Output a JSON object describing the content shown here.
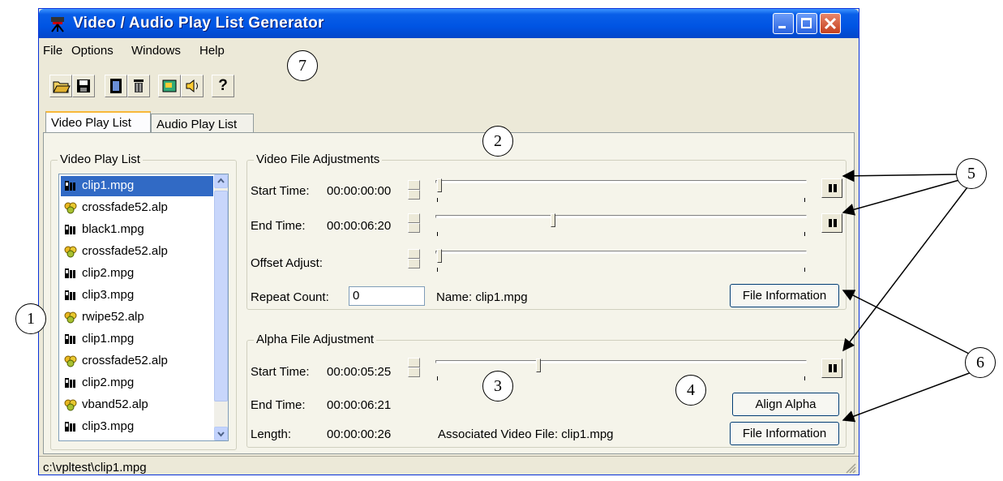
{
  "window": {
    "title": "Video / Audio Play List Generator"
  },
  "menu": {
    "items": [
      "File",
      "Options",
      "Windows",
      "Help"
    ]
  },
  "toolbar": {
    "icons": [
      "open-folder-icon",
      "save-icon",
      "film-icon",
      "trash-icon",
      "video-effect-icon",
      "speaker-icon",
      "help-icon"
    ],
    "help_label": "?"
  },
  "tabs": [
    {
      "label": "Video Play List",
      "active": true
    },
    {
      "label": "Audio Play List",
      "active": false
    }
  ],
  "playlist": {
    "legend": "Video Play List",
    "items": [
      {
        "label": "clip1.mpg",
        "type": "video",
        "selected": true
      },
      {
        "label": "crossfade52.alp",
        "type": "alpha"
      },
      {
        "label": "black1.mpg",
        "type": "video"
      },
      {
        "label": "crossfade52.alp",
        "type": "alpha"
      },
      {
        "label": "clip2.mpg",
        "type": "video"
      },
      {
        "label": "clip3.mpg",
        "type": "video"
      },
      {
        "label": "rwipe52.alp",
        "type": "alpha"
      },
      {
        "label": "clip1.mpg",
        "type": "video"
      },
      {
        "label": "crossfade52.alp",
        "type": "alpha"
      },
      {
        "label": "clip2.mpg",
        "type": "video"
      },
      {
        "label": "vband52.alp",
        "type": "alpha"
      },
      {
        "label": "clip3.mpg",
        "type": "video"
      }
    ]
  },
  "video_adjust": {
    "legend": "Video File Adjustments",
    "start_label": "Start Time:",
    "start_value": "00:00:00:00",
    "start_slider": 0.0,
    "end_label": "End Time:",
    "end_value": "00:00:06:20",
    "end_slider": 0.31,
    "offset_label": "Offset Adjust:",
    "offset_slider": 0.0,
    "repeat_label": "Repeat Count:",
    "repeat_value": "0",
    "name_text": "Name: clip1.mpg",
    "file_info_label": "File Information"
  },
  "alpha_adjust": {
    "legend": "Alpha File Adjustment",
    "start_label": "Start Time:",
    "start_value": "00:00:05:25",
    "start_slider": 0.27,
    "end_label": "End Time:",
    "end_value": "00:00:06:21",
    "length_label": "Length:",
    "length_value": "00:00:00:26",
    "assoc_text": "Associated Video File: clip1.mpg",
    "align_label": "Align Alpha",
    "file_info_label": "File Information"
  },
  "status": {
    "path": "c:\\vpltest\\clip1.mpg"
  },
  "callouts": [
    "1",
    "2",
    "3",
    "4",
    "5",
    "6",
    "7"
  ]
}
